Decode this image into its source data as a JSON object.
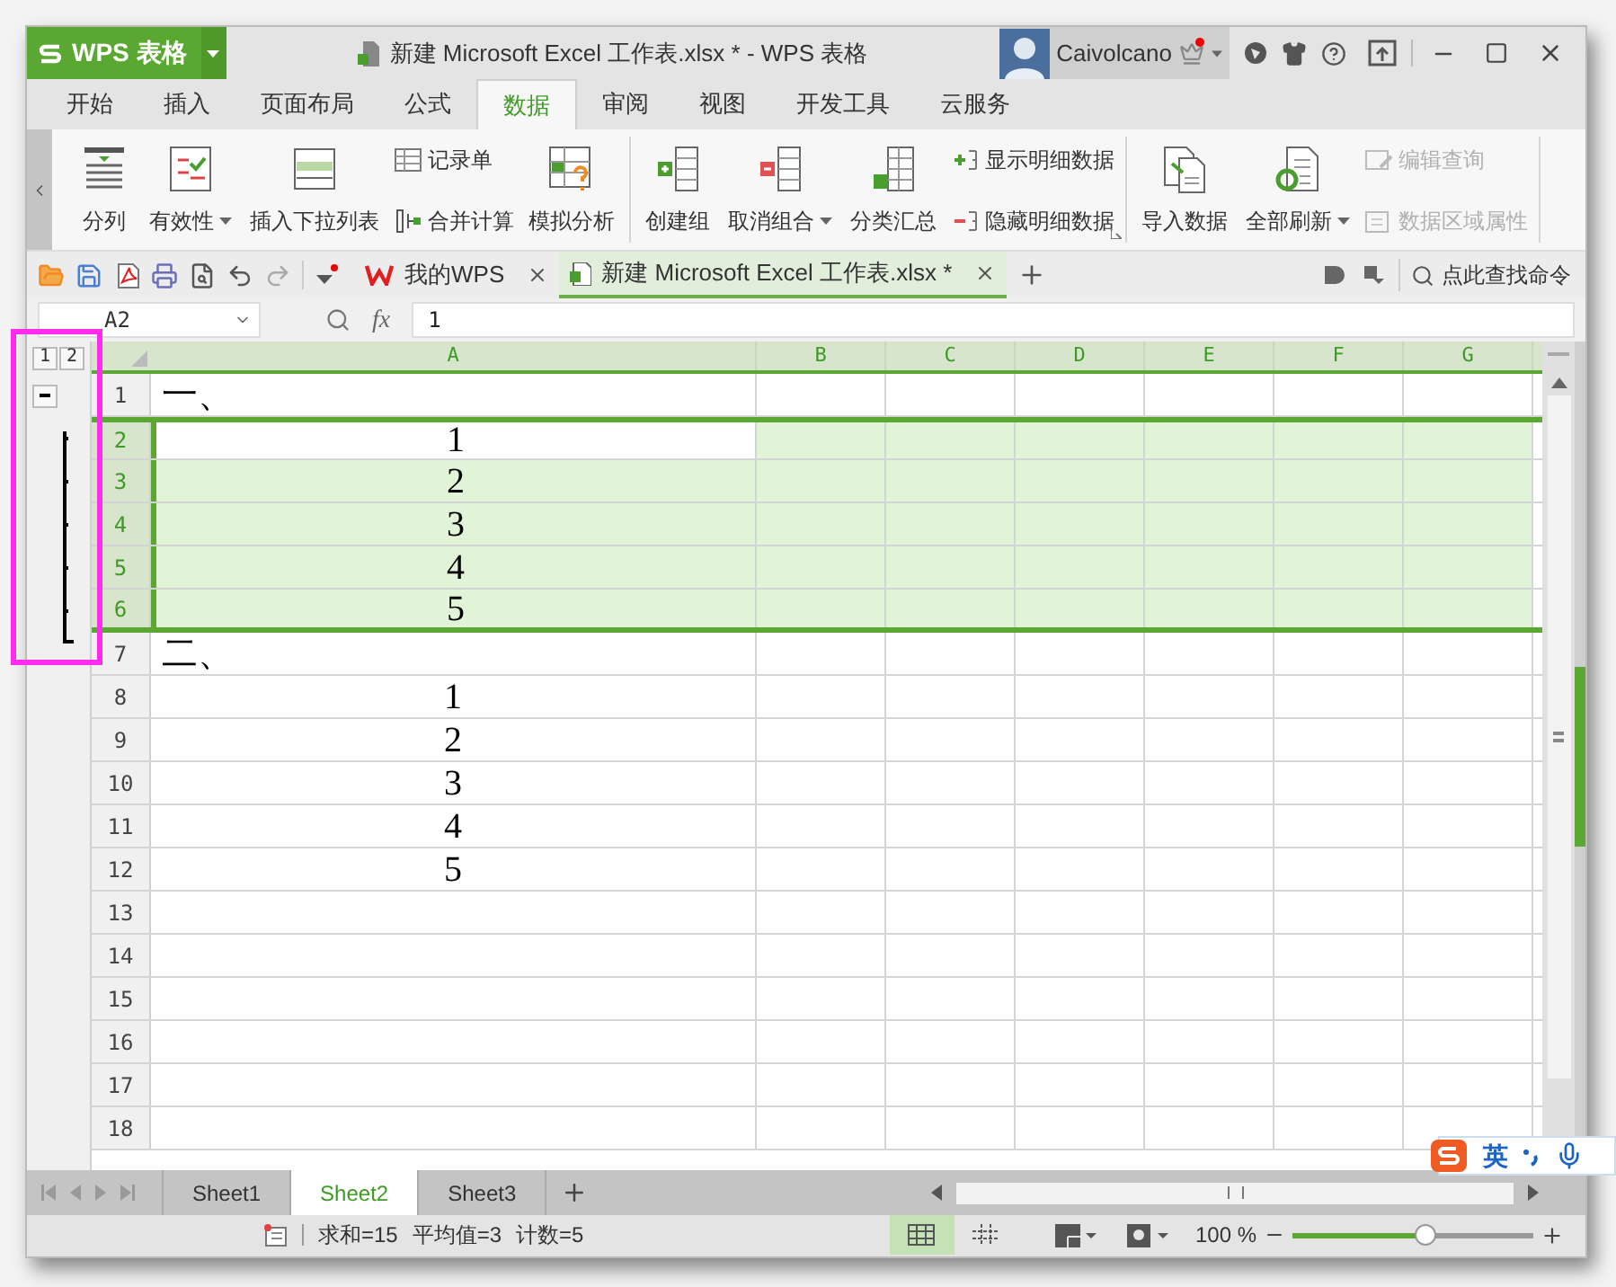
{
  "app_button": {
    "label": "WPS 表格"
  },
  "window": {
    "title": "新建 Microsoft Excel 工作表.xlsx * - WPS 表格"
  },
  "user": {
    "name": "Caivolcano",
    "notification": true
  },
  "ribbon_tabs": [
    {
      "label": "开始",
      "selected": false
    },
    {
      "label": "插入",
      "selected": false
    },
    {
      "label": "页面布局",
      "selected": false
    },
    {
      "label": "公式",
      "selected": false
    },
    {
      "label": "数据",
      "selected": true
    },
    {
      "label": "审阅",
      "selected": false
    },
    {
      "label": "视图",
      "selected": false
    },
    {
      "label": "开发工具",
      "selected": false
    },
    {
      "label": "云服务",
      "selected": false
    }
  ],
  "ribbon_groups": [
    {
      "launcher": false,
      "items": [
        {
          "kind": "large",
          "label": "分列",
          "dropdown": false
        },
        {
          "kind": "large",
          "label": "有效性",
          "dropdown": true
        },
        {
          "kind": "large",
          "label": "插入下拉列表",
          "dropdown": false
        },
        {
          "kind": "stack",
          "items": [
            {
              "label": "记录单",
              "disabled": false
            },
            {
              "label": "合并计算",
              "disabled": false
            }
          ]
        },
        {
          "kind": "large",
          "label": "模拟分析",
          "dropdown": false
        }
      ]
    },
    {
      "launcher": true,
      "items": [
        {
          "kind": "large",
          "label": "创建组",
          "dropdown": false
        },
        {
          "kind": "large",
          "label": "取消组合",
          "dropdown": true
        },
        {
          "kind": "large",
          "label": "分类汇总",
          "dropdown": false
        },
        {
          "kind": "stack",
          "items": [
            {
              "label": "显示明细数据",
              "disabled": false
            },
            {
              "label": "隐藏明细数据",
              "disabled": false
            }
          ]
        }
      ]
    },
    {
      "launcher": false,
      "items": [
        {
          "kind": "large",
          "label": "导入数据",
          "dropdown": false
        },
        {
          "kind": "large",
          "label": "全部刷新",
          "dropdown": true
        },
        {
          "kind": "stack",
          "items": [
            {
              "label": "编辑查询",
              "disabled": true
            },
            {
              "label": "数据区域属性",
              "disabled": true
            }
          ]
        }
      ]
    }
  ],
  "doc_tabs": [
    {
      "label": "我的WPS",
      "selected": false
    },
    {
      "label": "新建 Microsoft Excel 工作表.xlsx *",
      "selected": true
    }
  ],
  "command_search": {
    "placeholder": "点此查找命令"
  },
  "name_box": {
    "value": "A2"
  },
  "formula_bar": {
    "fx": "fx",
    "value": "1"
  },
  "outline_levels": [
    "1",
    "2"
  ],
  "columns": [
    {
      "label": "A"
    },
    {
      "label": "B"
    },
    {
      "label": "C"
    },
    {
      "label": "D"
    },
    {
      "label": "E"
    },
    {
      "label": "F"
    },
    {
      "label": "G"
    }
  ],
  "rows": [
    {
      "number": "1",
      "selected": false,
      "active": false,
      "group_toggle": true,
      "grouped": false,
      "kind": "heading",
      "value": "一、"
    },
    {
      "number": "2",
      "selected": true,
      "active": true,
      "group_toggle": false,
      "grouped": true,
      "kind": "number",
      "value": "1"
    },
    {
      "number": "3",
      "selected": true,
      "active": false,
      "group_toggle": false,
      "grouped": true,
      "kind": "number",
      "value": "2"
    },
    {
      "number": "4",
      "selected": true,
      "active": false,
      "group_toggle": false,
      "grouped": true,
      "kind": "number",
      "value": "3"
    },
    {
      "number": "5",
      "selected": true,
      "active": false,
      "group_toggle": false,
      "grouped": true,
      "kind": "number",
      "value": "4"
    },
    {
      "number": "6",
      "selected": true,
      "active": false,
      "group_toggle": false,
      "grouped": true,
      "kind": "number",
      "value": "5"
    },
    {
      "number": "7",
      "selected": false,
      "active": false,
      "group_toggle": false,
      "grouped": false,
      "kind": "heading",
      "value": "二、"
    },
    {
      "number": "8",
      "selected": false,
      "active": false,
      "group_toggle": false,
      "grouped": false,
      "kind": "number",
      "value": "1"
    },
    {
      "number": "9",
      "selected": false,
      "active": false,
      "group_toggle": false,
      "grouped": false,
      "kind": "number",
      "value": "2"
    },
    {
      "number": "10",
      "selected": false,
      "active": false,
      "group_toggle": false,
      "grouped": false,
      "kind": "number",
      "value": "3"
    },
    {
      "number": "11",
      "selected": false,
      "active": false,
      "group_toggle": false,
      "grouped": false,
      "kind": "number",
      "value": "4"
    },
    {
      "number": "12",
      "selected": false,
      "active": false,
      "group_toggle": false,
      "grouped": false,
      "kind": "number",
      "value": "5"
    },
    {
      "number": "13",
      "selected": false,
      "active": false,
      "group_toggle": false,
      "grouped": false,
      "kind": "empty"
    },
    {
      "number": "14",
      "selected": false,
      "active": false,
      "group_toggle": false,
      "grouped": false,
      "kind": "empty"
    },
    {
      "number": "15",
      "selected": false,
      "active": false,
      "group_toggle": false,
      "grouped": false,
      "kind": "empty"
    },
    {
      "number": "16",
      "selected": false,
      "active": false,
      "group_toggle": false,
      "grouped": false,
      "kind": "empty"
    },
    {
      "number": "17",
      "selected": false,
      "active": false,
      "group_toggle": false,
      "grouped": false,
      "kind": "empty"
    },
    {
      "number": "18",
      "selected": false,
      "active": false,
      "group_toggle": false,
      "grouped": false,
      "kind": "empty"
    }
  ],
  "sheets": [
    {
      "label": "Sheet1",
      "selected": false
    },
    {
      "label": "Sheet2",
      "selected": true
    },
    {
      "label": "Sheet3",
      "selected": false
    }
  ],
  "status": {
    "items": [
      "求和=15",
      "平均值=3",
      "计数=5"
    ],
    "zoom": "100 %",
    "level": 0.55
  },
  "view_modes": [
    {
      "selected": true
    },
    {
      "selected": false
    }
  ],
  "ime": {
    "label": "英"
  }
}
